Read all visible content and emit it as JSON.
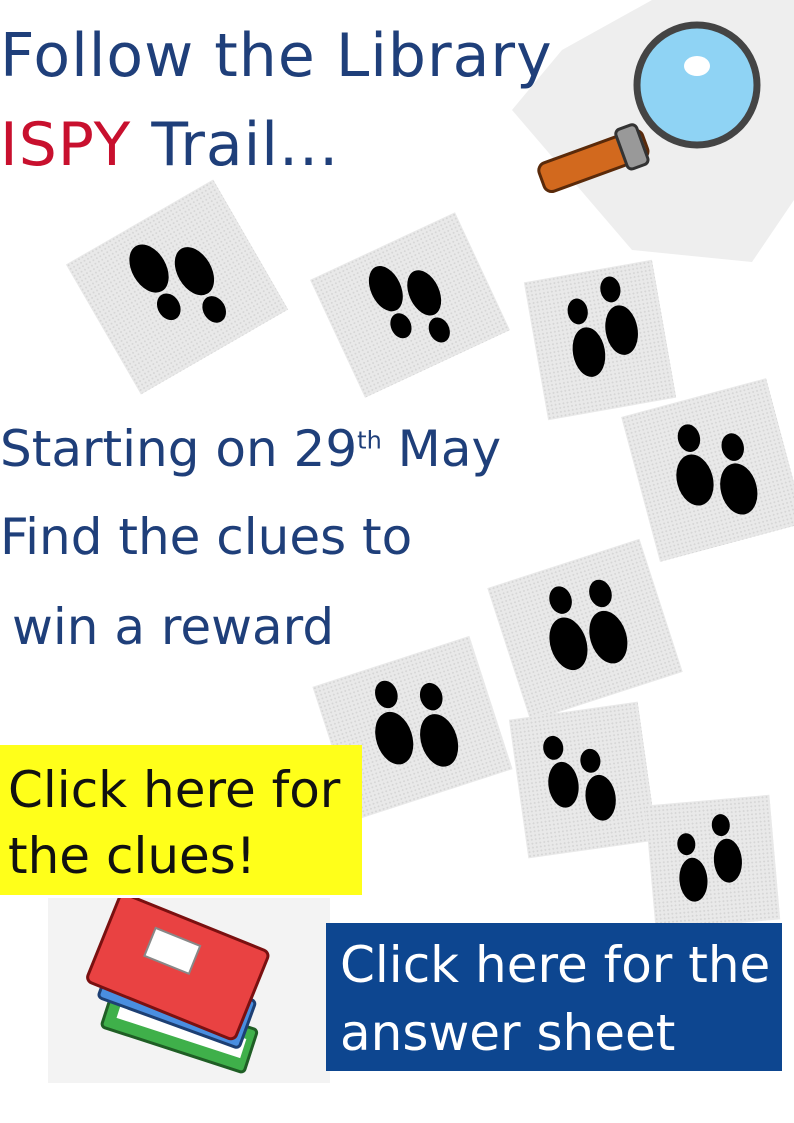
{
  "heading": {
    "line1": "Follow the Library",
    "line2_highlight": "ISPY",
    "line2_rest": " Trail..."
  },
  "details": {
    "start_prefix": "Starting on 29",
    "start_sup": "th",
    "start_suffix": " May",
    "line2": "Find the clues to",
    "line3": "win a reward"
  },
  "buttons": {
    "clues_line1": "Click here for",
    "clues_line2": "the clues!",
    "answer_line1": "Click here for the",
    "answer_line2": "answer sheet"
  },
  "colors": {
    "title_blue": "#1f3f7a",
    "ispy_red": "#c8102e",
    "clues_yellow": "#ffff1a",
    "answer_blue": "#0d4690"
  },
  "icons": [
    "magnifying-glass-icon",
    "footprints-icon",
    "books-icon"
  ]
}
